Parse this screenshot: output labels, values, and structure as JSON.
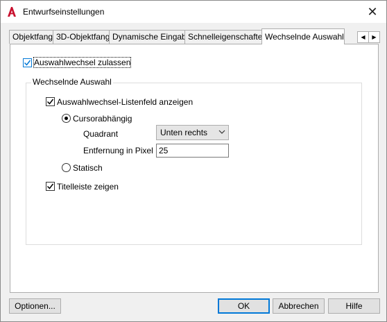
{
  "window": {
    "title": "Entwurfseinstellungen",
    "close_glyph": "✕",
    "accent": "#0078d7",
    "app_icon": "autocad-a-icon"
  },
  "tabs": [
    {
      "label": "Objektfang"
    },
    {
      "label": "3D-Objektfang"
    },
    {
      "label": "Dynamische Eingabe"
    },
    {
      "label": "Schnelleigenschaften"
    },
    {
      "label": "Wechselnde Auswahl",
      "active": true
    }
  ],
  "tab_scroll": {
    "left": "◀",
    "right": "▶"
  },
  "allow_cycling": {
    "label": "Auswahlwechsel zulassen",
    "checked": true
  },
  "group": {
    "title": "Wechselnde Auswahl",
    "show_list": {
      "label": "Auswahlwechsel-Listenfeld anzeigen",
      "checked": true
    },
    "cursor_dependent": {
      "label": "Cursorabhängig",
      "selected": true
    },
    "quadrant": {
      "label": "Quadrant",
      "value": "Unten rechts"
    },
    "distance": {
      "label": "Entfernung in Pixel",
      "value": "25"
    },
    "static": {
      "label": "Statisch",
      "selected": false
    },
    "show_titlebar": {
      "label": "Titelleiste zeigen",
      "checked": true
    }
  },
  "buttons": {
    "options": "Optionen...",
    "ok": "OK",
    "cancel": "Abbrechen",
    "help": "Hilfe"
  }
}
